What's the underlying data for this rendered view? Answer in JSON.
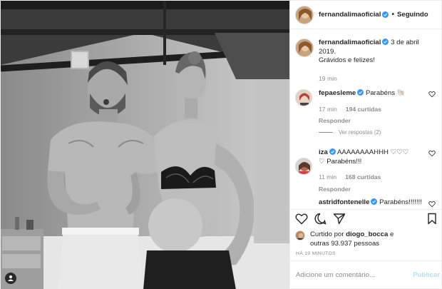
{
  "header": {
    "username": "fernandalimaoficial",
    "separator": "•",
    "follow_status": "Seguindo"
  },
  "caption": {
    "username": "fernandalimaoficial",
    "date_text": "3 de abril 2019.",
    "text": "Grávidos e felizes!",
    "time": "19 min"
  },
  "comments": [
    {
      "username": "fepaesleme",
      "text": "Parabéns",
      "emoji": "🐚",
      "time": "17 min",
      "likes": "194 curtidas",
      "reply": "Responder"
    },
    {
      "username": "iza",
      "text": "AAAAAAAAHHH ♡♡♡",
      "text2": "♡ Parabéns!!!",
      "time": "11 min",
      "likes": "168 curtidas",
      "reply": "Responder"
    },
    {
      "username": "astridfontenelle",
      "text": "Parabéns!!!!!!!"
    }
  ],
  "view_replies": "Ver respostas (2)",
  "likes": {
    "prefix": "Curtido por",
    "user": "diogo_bocca",
    "middle": "e",
    "others": "outras 93.937 pessoas"
  },
  "time_ago": "HÁ 19 MINUTOS",
  "comment_input": {
    "placeholder": "Adicione um comentário..."
  },
  "publish_label": "Publicar",
  "colors": {
    "verified": "#3897f0",
    "muted": "#8e8e8e",
    "publish_disabled": "#b2dffc"
  },
  "icons": [
    "verified-icon",
    "heart-icon",
    "comment-icon",
    "share-icon",
    "bookmark-icon",
    "user-tag-icon"
  ]
}
